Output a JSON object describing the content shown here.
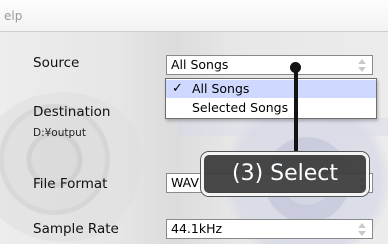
{
  "window": {
    "title": "elp"
  },
  "source": {
    "label": "Source",
    "value": "All Songs"
  },
  "dropdown": {
    "options": [
      "All Songs",
      "Selected Songs"
    ],
    "selected": "All Songs",
    "check_glyph": "✓"
  },
  "destination": {
    "label": "Destination",
    "path": "D:¥output"
  },
  "file_format": {
    "label": "File Format",
    "value": "WAV"
  },
  "sample_rate": {
    "label": "Sample Rate",
    "value": "44.1kHz"
  },
  "callout": {
    "text": "(3) Select"
  },
  "colors": {
    "selected_option_bg": "#cfd9ff",
    "callout_bg": "#3a3a3a"
  }
}
